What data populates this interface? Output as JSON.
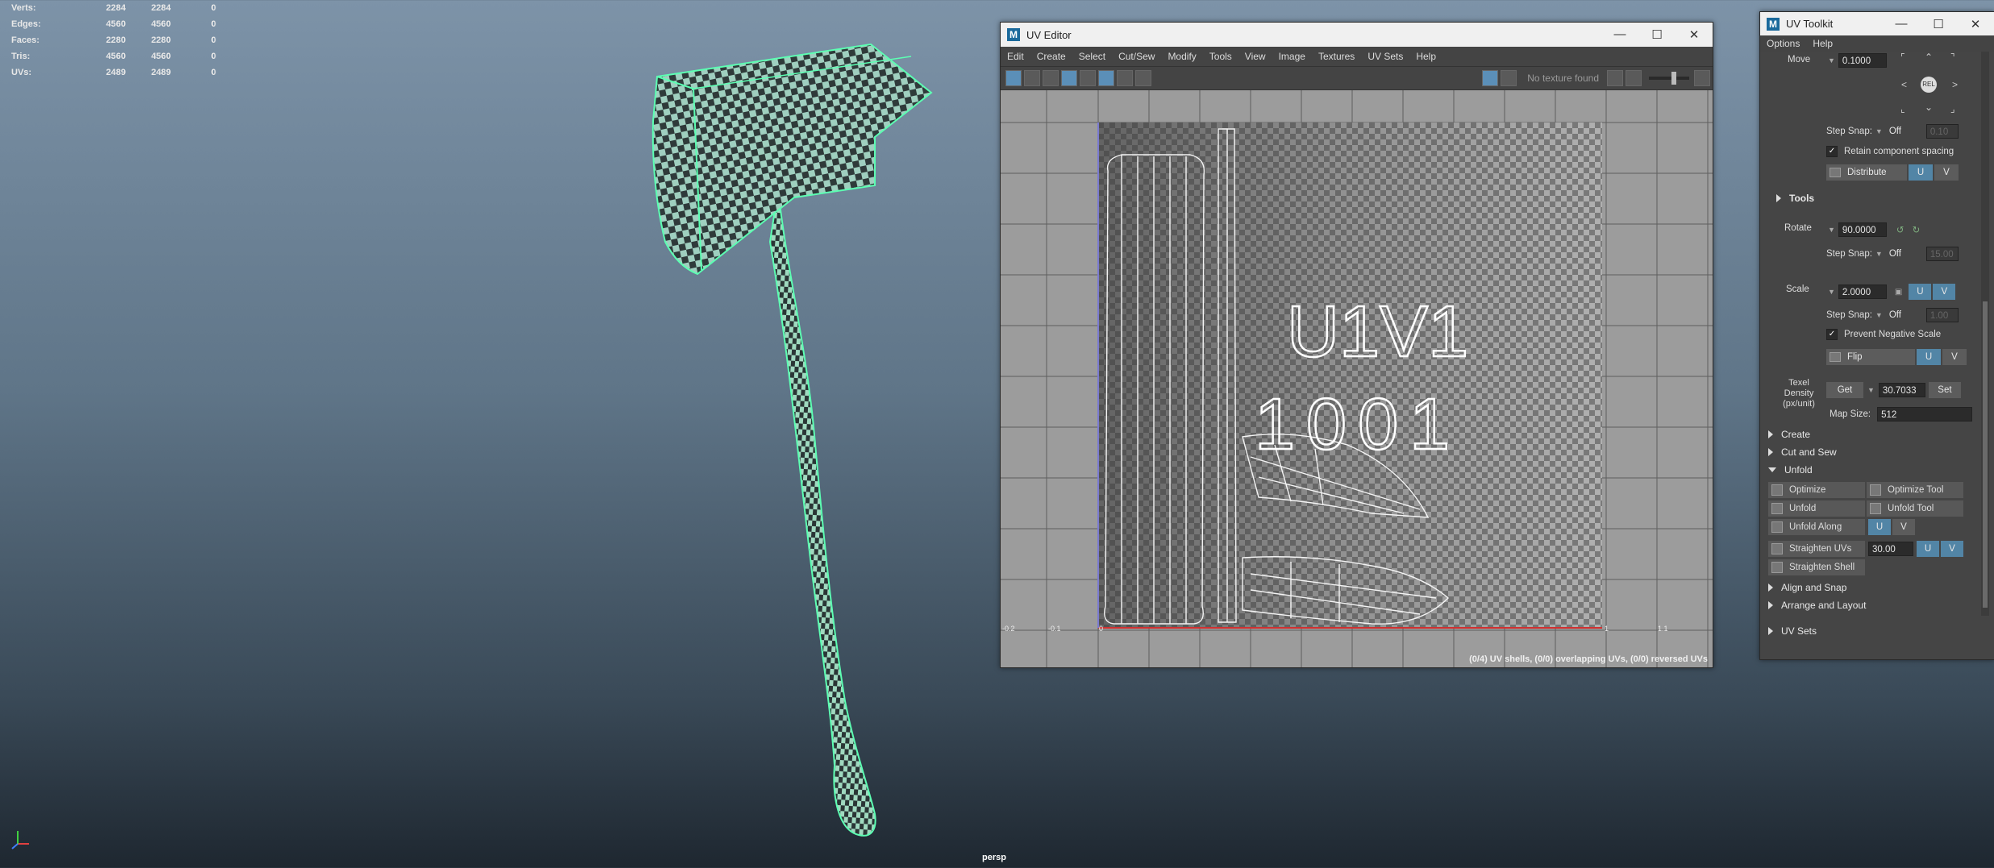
{
  "viewport": {
    "camera_label": "persp",
    "hud": {
      "rows": [
        {
          "label": "Verts:",
          "v1": "2284",
          "v2": "2284",
          "v3": "0"
        },
        {
          "label": "Edges:",
          "v1": "4560",
          "v2": "4560",
          "v3": "0"
        },
        {
          "label": "Faces:",
          "v1": "2280",
          "v2": "2280",
          "v3": "0"
        },
        {
          "label": "Tris:",
          "v1": "4560",
          "v2": "4560",
          "v3": "0"
        },
        {
          "label": "UVs:",
          "v1": "2489",
          "v2": "2489",
          "v3": "0"
        }
      ]
    }
  },
  "uv_editor": {
    "title": "UV Editor",
    "menu": [
      "Edit",
      "Create",
      "Select",
      "Cut/Sew",
      "Modify",
      "Tools",
      "View",
      "Image",
      "Textures",
      "UV Sets",
      "Help"
    ],
    "texture_label": "No texture found",
    "tile_label_1": "U1V1",
    "tile_label_2": "1001",
    "axis_labels": {
      "neg02": "-0.2",
      "neg01": "-0.1",
      "zero": "0",
      "one": "1",
      "one_one": "1.1"
    },
    "status": "(0/4) UV shells, (0/0) overlapping UVs, (0/0) reversed UVs"
  },
  "uv_toolkit": {
    "title": "UV Toolkit",
    "menu": [
      "Options",
      "Help"
    ],
    "move_label": "Move",
    "move_value": "0.1000",
    "rel_label": "REL",
    "step_snap_label": "Step Snap:",
    "step_snap_value": "Off",
    "move_snap_value": "0.10",
    "retain_label": "Retain component spacing",
    "distribute_label": "Distribute",
    "u_label": "U",
    "v_label": "V",
    "tools_label": "Tools",
    "rotate_label": "Rotate",
    "rotate_value": "90.0000",
    "rotate_snap_value": "15.00",
    "scale_label": "Scale",
    "scale_value": "2.0000",
    "scale_snap_value": "1.00",
    "prevent_neg_label": "Prevent Negative Scale",
    "flip_label": "Flip",
    "texel_label_1": "Texel",
    "texel_label_2": "Density",
    "texel_label_3": "(px/unit)",
    "get_label": "Get",
    "texel_value": "30.7033",
    "set_label": "Set",
    "map_size_label": "Map Size:",
    "map_size_value": "512",
    "sections": {
      "create": "Create",
      "cut_sew": "Cut and Sew",
      "unfold": "Unfold",
      "align": "Align and Snap",
      "arrange": "Arrange and Layout",
      "uv_sets": "UV Sets"
    },
    "unfold_tools": {
      "optimize": "Optimize",
      "optimize_tool": "Optimize Tool",
      "unfold": "Unfold",
      "unfold_tool": "Unfold Tool",
      "unfold_along": "Unfold Along",
      "straighten_uvs": "Straighten UVs",
      "straighten_value": "30.00",
      "straighten_shell": "Straighten Shell"
    }
  }
}
